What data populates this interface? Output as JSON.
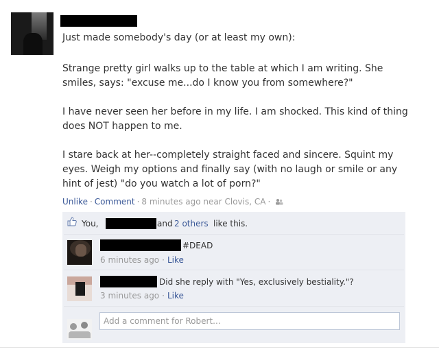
{
  "post": {
    "lines": [
      "Just made somebody's day (or at least my own):",
      "Strange pretty girl walks up to the table at which I am writing. She",
      "smiles, says: \"excuse me...do I know you from somewhere?\"",
      "I have never seen her before in my life. I am shocked. This kind of thing",
      "does NOT happen to me.",
      "I stare back at her--completely straight faced and sincere. Squint my",
      "eyes. Weigh my options and finally say (with no laugh or smile or any",
      "hint of jest) \"do you watch a lot of porn?\""
    ],
    "meta": {
      "unlike": "Unlike",
      "comment": "Comment",
      "time": "8 minutes ago near Clovis, CA",
      "sep": "·"
    }
  },
  "likes": {
    "prefix": "You,",
    "and": "and",
    "others": "2 others",
    "suffix": "like this."
  },
  "comments": [
    {
      "text": "#DEAD",
      "time": "6 minutes ago",
      "like": "Like"
    },
    {
      "text": "Did she reply with \"Yes, exclusively bestiality.\"?",
      "time": "3 minutes ago",
      "like": "Like"
    }
  ],
  "composer": {
    "placeholder": "Add a comment for Robert..."
  },
  "colors": {
    "link": "#3b5998",
    "meta": "#999999",
    "ufi_bg": "#edeff4",
    "input_border": "#bdc7d8"
  },
  "icons": {
    "like": "thumbs-up-icon",
    "audience": "people-icon"
  }
}
